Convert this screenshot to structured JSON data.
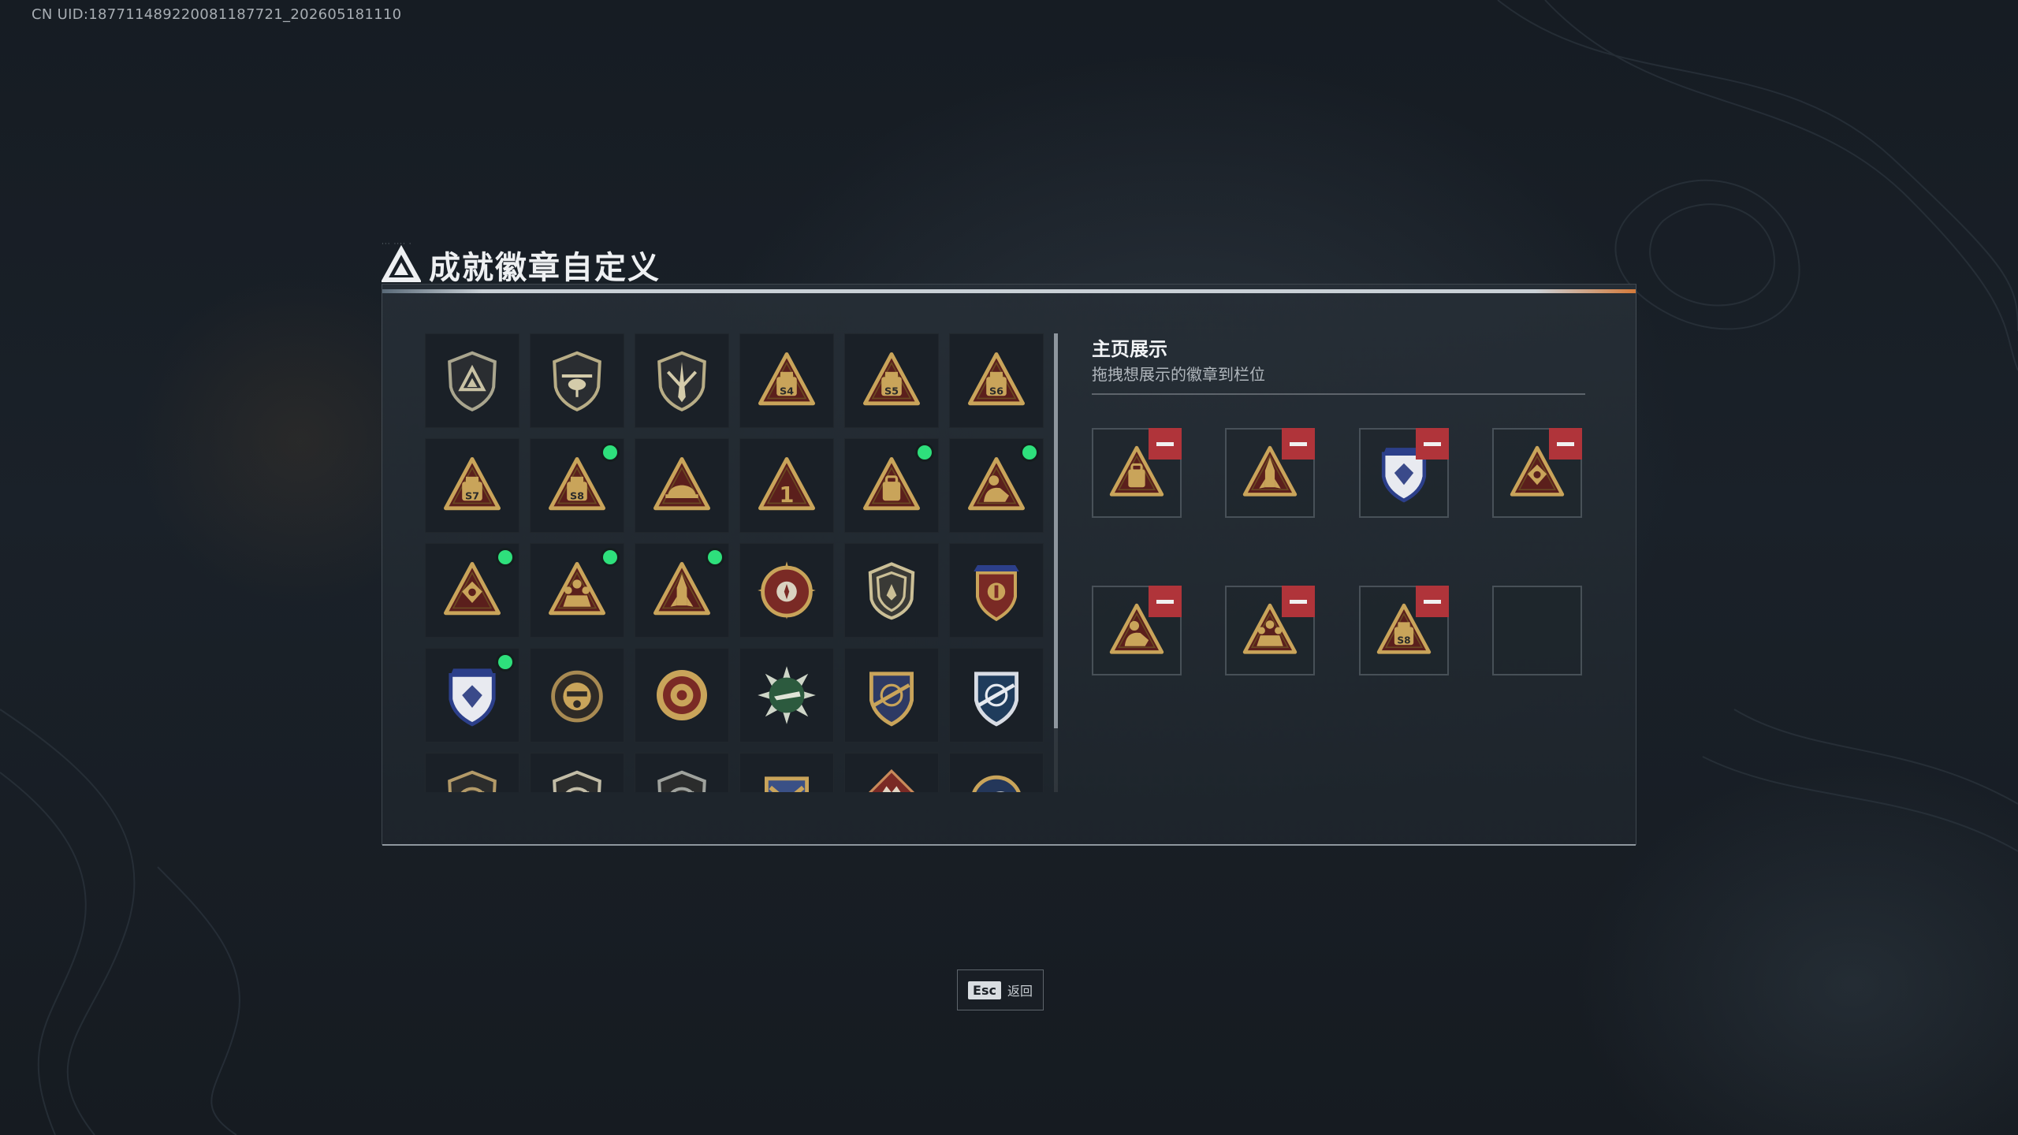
{
  "uid_text": "CN UID:18771148922008118​7721_202605181110",
  "header": {
    "title": "成就徽章自定义",
    "logo_icon": "delta-triangle-icon"
  },
  "badge_grid": {
    "badges": [
      {
        "icon": "delta-shield-badge",
        "new": false
      },
      {
        "icon": "helicopter-shield-badge",
        "new": false
      },
      {
        "icon": "blade-shield-badge",
        "new": false
      },
      {
        "icon": "s4-season-badge",
        "new": false,
        "label": "S4"
      },
      {
        "icon": "s5-season-badge",
        "new": false,
        "label": "S5"
      },
      {
        "icon": "s6-season-badge",
        "new": false,
        "label": "S6"
      },
      {
        "icon": "s7-season-badge",
        "new": false,
        "label": "S7"
      },
      {
        "icon": "s8-season-badge",
        "new": true,
        "label": "S8"
      },
      {
        "icon": "helmet-triangle-badge",
        "new": false
      },
      {
        "icon": "rank-one-triangle-badge",
        "new": false,
        "label": "1"
      },
      {
        "icon": "backpack-triangle-badge",
        "new": true
      },
      {
        "icon": "operator-triangle-badge",
        "new": true
      },
      {
        "icon": "emblem-triangle-badge",
        "new": true
      },
      {
        "icon": "squad-triangle-badge",
        "new": true
      },
      {
        "icon": "rocket-triangle-badge",
        "new": true
      },
      {
        "icon": "compass-star-badge",
        "new": false
      },
      {
        "icon": "winged-shield-badge",
        "new": false
      },
      {
        "icon": "starred-crest-badge",
        "new": false
      },
      {
        "icon": "blue-crest-badge",
        "new": true
      },
      {
        "icon": "scope-operator-badge",
        "new": false
      },
      {
        "icon": "gold-rose-badge",
        "new": false
      },
      {
        "icon": "green-burst-badge",
        "new": false
      },
      {
        "icon": "sniper-crest-badge",
        "new": false
      },
      {
        "icon": "blue-sniper-crest-badge",
        "new": false
      },
      {
        "icon": "rifle-shield-bronze-badge",
        "new": false
      },
      {
        "icon": "rifle-shield-silver-badge",
        "new": false
      },
      {
        "icon": "rifle-shield-steel-badge",
        "new": false
      },
      {
        "icon": "crossed-rifles-crest-badge",
        "new": false
      },
      {
        "icon": "wolf-diamond-badge",
        "new": false
      },
      {
        "icon": "eagle-round-badge",
        "new": false
      }
    ]
  },
  "showcase": {
    "title": "主页展示",
    "subtitle": "拖拽想展示的徽章到栏位",
    "slots": [
      {
        "icon": "backpack-triangle-badge",
        "filled": true
      },
      {
        "icon": "rocket-triangle-badge",
        "filled": true
      },
      {
        "icon": "blue-crest-badge",
        "filled": true
      },
      {
        "icon": "emblem-triangle-badge",
        "filled": true
      },
      {
        "icon": "operator-triangle-badge",
        "filled": true
      },
      {
        "icon": "squad-triangle-badge",
        "filled": true
      },
      {
        "icon": "s8-season-badge",
        "filled": true,
        "label": "S8"
      },
      {
        "icon": "",
        "filled": false
      }
    ]
  },
  "footer": {
    "esc_key": "Esc",
    "back_label": "返回"
  },
  "colors": {
    "gold": "#c9a45a",
    "gold_dark": "#6b4a22",
    "maroon": "#5b1f1c",
    "new_dot": "#2ee07c",
    "remove": "#b0343a"
  },
  "scroll": {
    "position": 0.0,
    "visible_fraction": 0.86
  }
}
